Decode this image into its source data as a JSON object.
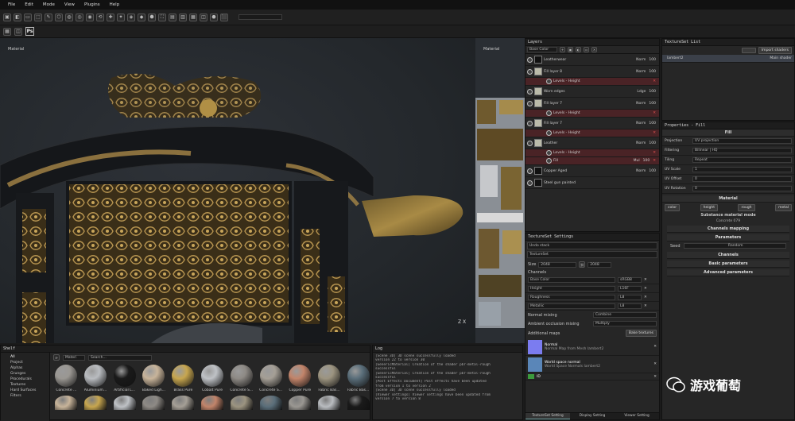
{
  "menu": [
    "File",
    "Edit",
    "Mode",
    "View",
    "Plugins",
    "Help"
  ],
  "toolbar2": {
    "ps_label": "Ps"
  },
  "viewport": {
    "label_main": "Material",
    "label_uv": "Material",
    "axis_label": "Z X"
  },
  "layers": {
    "title": "Layers",
    "channel_select": "Base Color",
    "rows": [
      {
        "name": "Leatherwear",
        "blend": "Norm",
        "opacity": "100",
        "type": "folder"
      },
      {
        "name": "Fill layer 8",
        "blend": "Norm",
        "opacity": "100",
        "type": "fill"
      },
      {
        "name": "Levels - Height",
        "type": "effect"
      },
      {
        "name": "Worn edges",
        "blend": "Ldge",
        "opacity": "100",
        "type": "fill"
      },
      {
        "name": "Fill layer 7",
        "blend": "Norm",
        "opacity": "100",
        "type": "fill"
      },
      {
        "name": "Levels - Height",
        "type": "effect"
      },
      {
        "name": "Fill layer 7",
        "blend": "Norm",
        "opacity": "100",
        "type": "fill"
      },
      {
        "name": "Levels - Height",
        "type": "effect"
      },
      {
        "name": "Leather",
        "blend": "Norm",
        "opacity": "100",
        "type": "fill"
      },
      {
        "name": "Levels - Height",
        "type": "effect"
      },
      {
        "name": "Fill",
        "blend": "Mul",
        "opacity": "100",
        "type": "effect"
      },
      {
        "name": "Copper Aged",
        "blend": "Norm",
        "opacity": "100",
        "type": "folder"
      },
      {
        "name": "Steel gun painted",
        "blend": "",
        "opacity": "",
        "type": "folder"
      }
    ]
  },
  "textureset_list": {
    "title": "TextureSet List",
    "import_label": "Import shaders",
    "item": "lambert2",
    "shader": "Main shader"
  },
  "textureset_settings": {
    "title": "TextureSet Settings",
    "undo_stack": "Undo stack",
    "textureset": "TextureSet",
    "size_label": "Size",
    "size_value": "2048",
    "size_value2": "2048",
    "channels_label": "Channels",
    "channels": [
      {
        "name": "Base Color",
        "format": "sRGB8"
      },
      {
        "name": "Height",
        "format": "L16F"
      },
      {
        "name": "Roughness",
        "format": "L8"
      },
      {
        "name": "Metallic",
        "format": "L8"
      }
    ],
    "normal_mixing_label": "Normal mixing",
    "normal_mixing_value": "Combine",
    "ao_label": "Ambient occlusion mixing",
    "ao_value": "Multiply",
    "additional_maps_label": "Additional maps",
    "bake_label": "Bake textures",
    "maps": [
      {
        "title": "Normal",
        "desc": "Normal Map from Mesh lambert2"
      },
      {
        "title": "World space normal",
        "desc": "World Space Normals lambert2"
      },
      {
        "title": "ID",
        "desc": ""
      }
    ],
    "tabs": [
      "TextureSet Setting",
      "Display Setting",
      "Viewer Setting"
    ]
  },
  "properties": {
    "title": "Properties - Fill",
    "fill_label": "Fill",
    "projection_label": "Projection",
    "projection_value": "UV projection",
    "filtering_label": "Filtering",
    "filtering_value": "Bilinear | HQ",
    "tiling_label": "Tiling",
    "tiling_value": "Repeat",
    "uvscale_label": "UV Scale",
    "uvscale_value": "1",
    "uvoffset_label": "UV Offset",
    "uvoffset_value": "0",
    "uvrot_label": "UV Rotation",
    "uvrot_value": "0",
    "material_label": "Material",
    "channel_buttons": [
      "color",
      "height",
      "rough",
      "metal"
    ],
    "substance_mode": "Substance material mode",
    "substance_name": "Concrete 079",
    "sections": [
      "Channels mapping",
      "Parameters",
      "Channels",
      "Basic parameters",
      "Advanced parameters"
    ],
    "seed_label": "Seed",
    "seed_value": "Random"
  },
  "shelf": {
    "title": "Shelf",
    "categories": [
      "All",
      "Project",
      "Alphas",
      "Grunges",
      "Procedurals",
      "Textures",
      "Hard Surfaces",
      "Filters"
    ],
    "filter_label": "Materi",
    "search_placeholder": "Search...",
    "materials": [
      {
        "label": "Concrete ...",
        "color": "#9a9792"
      },
      {
        "label": "Aluminium...",
        "color": "#b9bcc0"
      },
      {
        "label": "Artificial L...",
        "color": "#1a1a1a"
      },
      {
        "label": "Baked Ligh...",
        "color": "#c8b49a"
      },
      {
        "label": "Brass Pure",
        "color": "#c7a64f"
      },
      {
        "label": "Cobalt Pure",
        "color": "#bfc2c6"
      },
      {
        "label": "Concrete S...",
        "color": "#8e8a85"
      },
      {
        "label": "Concrete S...",
        "color": "#a59f96"
      },
      {
        "label": "Copper Pure",
        "color": "#c2846a"
      },
      {
        "label": "Fabric Bas...",
        "color": "#9c9480"
      },
      {
        "label": "Fabric Bas...",
        "color": "#5a6e7a"
      }
    ]
  },
  "log": {
    "title": "Log",
    "lines": [
      "[Scene 3D] 3D scene successfully loaded",
      "version 22 to version 30",
      "[GenericMaterial] Creation of the shader pbr-metal-rough",
      "successful",
      "[GenericMaterial] Creation of the shader pbr-metal-rough",
      "successful",
      "[Post Effects Document] Post effects have been updated",
      "from version 1 to version 2",
      "[Scene 3D] 3D scene successfully loaded",
      "[Viewer settings] Viewer settings have been updated from",
      "version 7 to version 8"
    ]
  },
  "watermark": {
    "text": "游戏葡萄"
  }
}
